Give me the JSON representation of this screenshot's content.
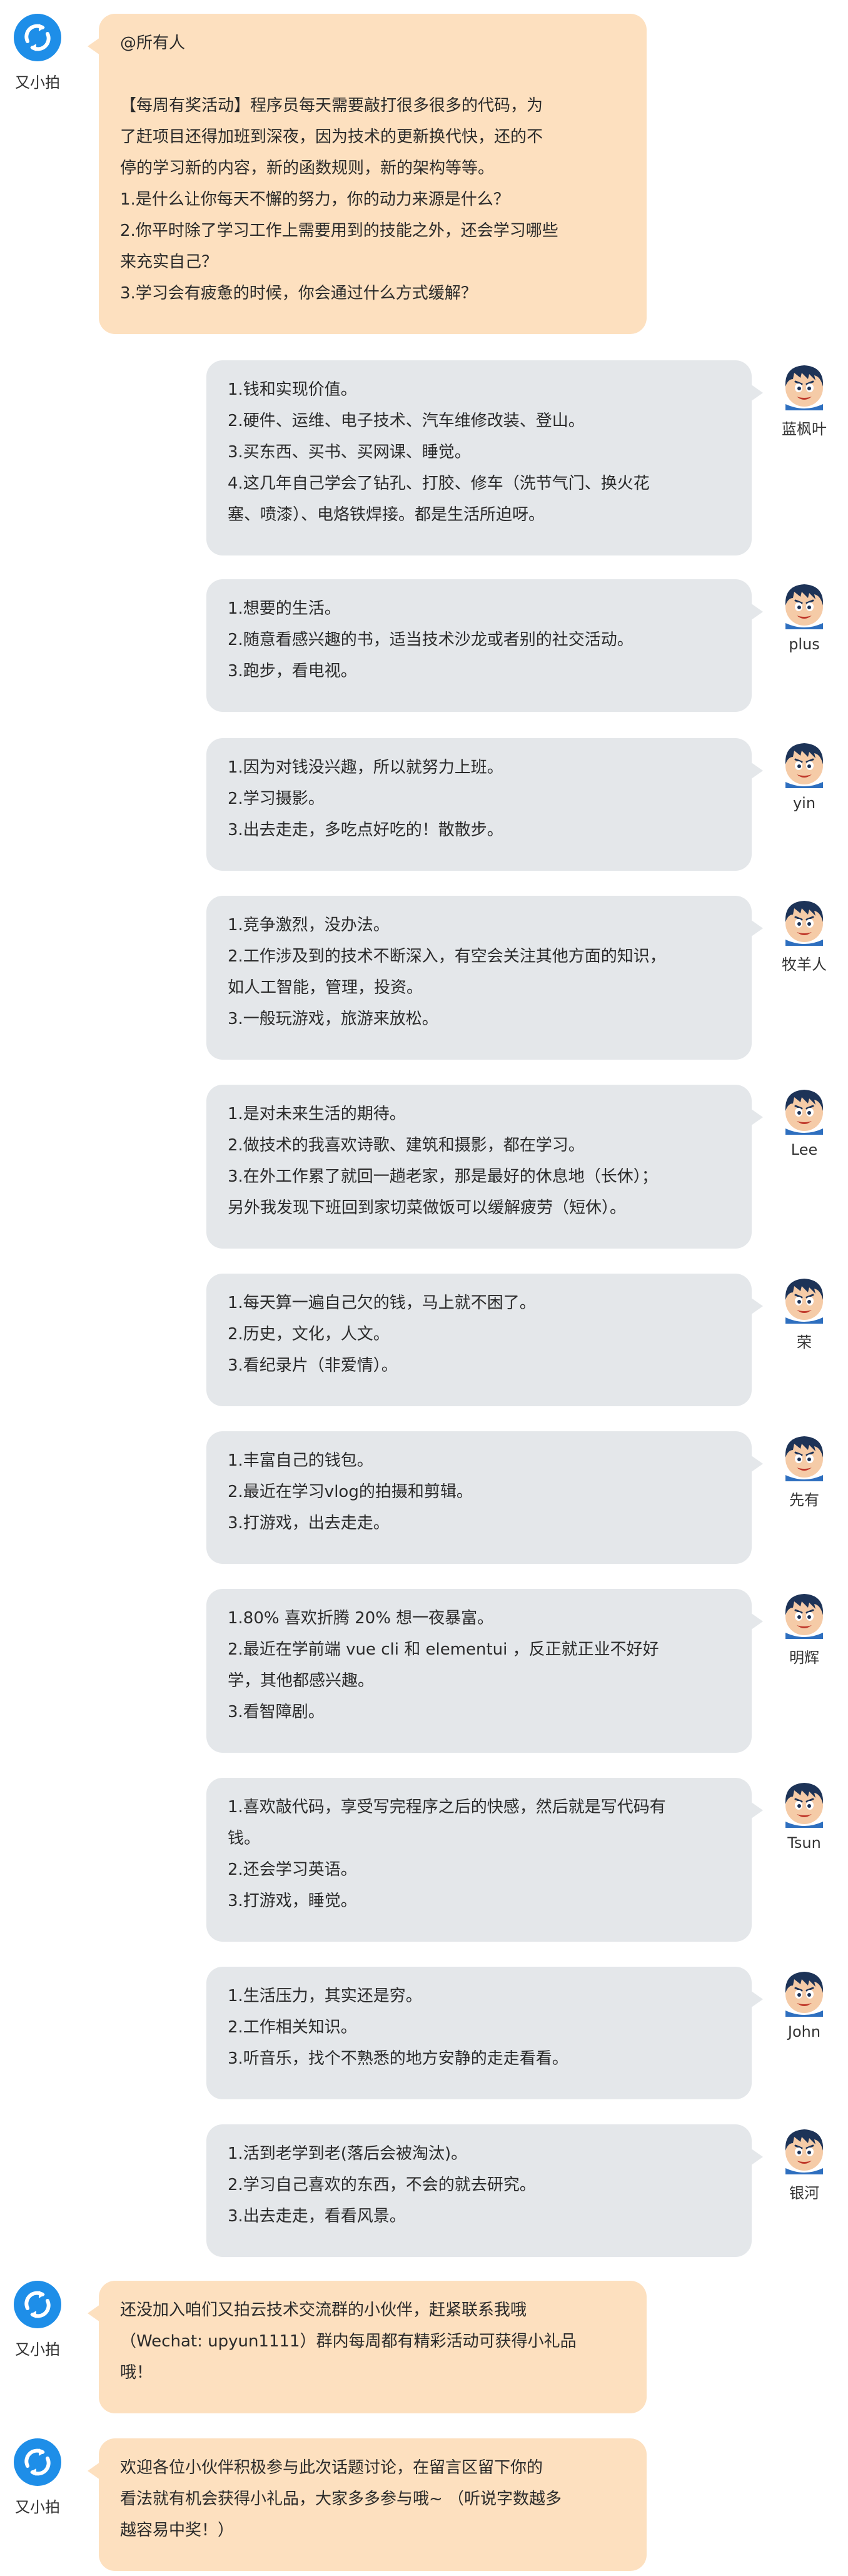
{
  "bot": {
    "name": "又小拍",
    "avatar_icon": "upyun-logo-icon",
    "color": "#1e8ee8"
  },
  "messages": [
    {
      "sender": "bot",
      "lines": [
        "@所有人",
        "",
        "【每周有奖活动】程序员每天需要敲打很多很多的代码，为",
        "了赶项目还得加班到深夜，因为技术的更新换代快，还的不",
        "停的学习新的内容，新的函数规则，新的架构等等。",
        "1.是什么让你每天不懈的努力，你的动力来源是什么？",
        "2.你平时除了学习工作上需要用到的技能之外，还会学习哪些",
        "来充实自己？",
        "3.学习会有疲惫的时候，你会通过什么方式缓解？"
      ]
    },
    {
      "sender": "user",
      "name": "蓝枫叶",
      "lines": [
        "1.钱和实现价值。",
        "2.硬件、运维、电子技术、汽车维修改装、登山。",
        "3.买东西、买书、买网课、睡觉。",
        "4.这几年自己学会了钻孔、打胶、修车（洗节气门、换火花",
        "塞、喷漆）、电烙铁焊接。都是生活所迫呀。"
      ]
    },
    {
      "sender": "user",
      "name": "plus",
      "lines": [
        "1.想要的生活。",
        "2.随意看感兴趣的书，适当技术沙龙或者别的社交活动。",
        "3.跑步，看电视。"
      ]
    },
    {
      "sender": "user",
      "name": "yin",
      "lines": [
        "1.因为对钱没兴趣，所以就努力上班。",
        "2.学习摄影。",
        "3.出去走走，多吃点好吃的！散散步。"
      ]
    },
    {
      "sender": "user",
      "name": "牧羊人",
      "lines": [
        "1.竞争激烈，没办法。",
        "2.工作涉及到的技术不断深入，有空会关注其他方面的知识，",
        "如人工智能，管理，投资。",
        "3.一般玩游戏，旅游来放松。"
      ]
    },
    {
      "sender": "user",
      "name": "Lee",
      "lines": [
        "1.是对未来生活的期待。",
        "2.做技术的我喜欢诗歌、建筑和摄影，都在学习。",
        "3.在外工作累了就回一趟老家，那是最好的休息地（长休）；",
        "另外我发现下班回到家切菜做饭可以缓解疲劳（短休）。"
      ]
    },
    {
      "sender": "user",
      "name": "荣",
      "lines": [
        "1.每天算一遍自己欠的钱，马上就不困了。",
        "2.历史，文化，人文。",
        "3.看纪录片（非爱情）。"
      ]
    },
    {
      "sender": "user",
      "name": "先有",
      "lines": [
        "1.丰富自己的钱包。",
        "2.最近在学习vlog的拍摄和剪辑。",
        "3.打游戏，出去走走。"
      ]
    },
    {
      "sender": "user",
      "name": "明辉",
      "lines": [
        "1.80% 喜欢折腾 20% 想一夜暴富。",
        "2.最近在学前端 vue cli 和 elementui ，反正就正业不好好",
        "学，其他都感兴趣。",
        "3.看智障剧。"
      ]
    },
    {
      "sender": "user",
      "name": "Tsun",
      "lines": [
        "1.喜欢敲代码，享受写完程序之后的快感，然后就是写代码有",
        "钱。",
        "2.还会学习英语。",
        "3.打游戏，睡觉。"
      ]
    },
    {
      "sender": "user",
      "name": "John",
      "lines": [
        "1.生活压力，其实还是穷。",
        "2.工作相关知识。",
        "3.听音乐，找个不熟悉的地方安静的走走看看。"
      ]
    },
    {
      "sender": "user",
      "name": "银河",
      "lines": [
        "1.活到老学到老(落后会被淘汰)。",
        "2.学习自己喜欢的东西，不会的就去研究。",
        "3.出去走走，看看风景。"
      ]
    },
    {
      "sender": "bot",
      "lines": [
        "还没加入咱们又拍云技术交流群的小伙伴，赶紧联系我哦",
        "（Wechat: upyun1111）群内每周都有精彩活动可获得小礼品",
        "哦！"
      ]
    },
    {
      "sender": "bot",
      "lines": [
        "欢迎各位小伙伴积极参与此次话题讨论，在留言区留下你的",
        "看法就有机会获得小礼品，大家多多参与哦~ （听说字数越多",
        "越容易中奖！）"
      ]
    }
  ]
}
